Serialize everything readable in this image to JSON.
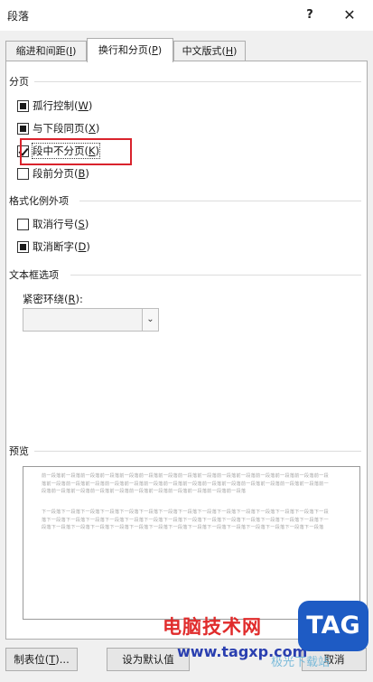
{
  "window": {
    "title": "段落",
    "help_label": "?",
    "close_label": "✕"
  },
  "tabs": [
    {
      "label": "缩进和间距(",
      "key": "I",
      "suffix": ")"
    },
    {
      "label": "换行和分页(",
      "key": "P",
      "suffix": ")"
    },
    {
      "label": "中文版式(",
      "key": "H",
      "suffix": ")"
    }
  ],
  "pagination": {
    "heading": "分页",
    "widow_control": {
      "label": "孤行控制(",
      "key": "W",
      "suffix": ")",
      "state": "indeterminate"
    },
    "keep_with_next": {
      "label": "与下段同页(",
      "key": "X",
      "suffix": ")",
      "state": "indeterminate"
    },
    "keep_lines_together": {
      "label": "段中不分页(",
      "key": "K",
      "suffix": ")",
      "state": "checked"
    },
    "page_break_before": {
      "label": "段前分页(",
      "key": "B",
      "suffix": ")",
      "state": "unchecked"
    }
  },
  "formatting_exceptions": {
    "heading": "格式化例外项",
    "suppress_line_numbers": {
      "label": "取消行号(",
      "key": "S",
      "suffix": ")",
      "state": "unchecked"
    },
    "dont_hyphenate": {
      "label": "取消断字(",
      "key": "D",
      "suffix": ")",
      "state": "indeterminate"
    }
  },
  "textbox_options": {
    "heading": "文本框选项",
    "tight_wrap_label": "紧密环绕(",
    "tight_wrap_key": "R",
    "tight_wrap_suffix": "):",
    "tight_wrap_value": ""
  },
  "preview": {
    "heading": "预览",
    "previous_paragraph": "前一段落前一段落前一段落前一段落前一段落前一段落前一段落前一段落前一段落前一段落前一段落前一段落前一段落前一段落前一段落前一段落前一段落前一段落前一段落前一段落前一段落前一段落前一段落前一段落前一段落前一段落前一段落前一段落前一段落前一段落前一段落前一段落前一段落前一段落前一段落前一段落前一段落前一段落前一段落前一段落",
    "next_paragraph": "下一段落下一段落下一段落下一段落下一段落下一段落下一段落下一段落下一段落下一段落下一段落下一段落下一段落下一段落下一段落下一段落下一段落下一段落下一段落下一段落下一段落下一段落下一段落下一段落下一段落下一段落下一段落下一段落下一段落下一段落下一段落下一段落下一段落下一段落下一段落下一段落下一段落下一段落下一段落下一段落下一段落下一段落下一段落下一段落"
  },
  "buttons": {
    "tabs_label": "制表位(",
    "tabs_key": "T",
    "tabs_suffix": ")...",
    "set_default_label": "设为默认值",
    "cancel_label": "取消"
  },
  "watermark": {
    "site_name": "电脑技术网",
    "site_url": "www.tagxp.com",
    "logo_text": "TAG",
    "faint_text": "极光下载站"
  },
  "colors": {
    "highlight_border": "#d9232c",
    "watermark_red": "#e02b2b",
    "watermark_blue": "#2a3fb0",
    "logo_blue": "#1e5bc4"
  }
}
